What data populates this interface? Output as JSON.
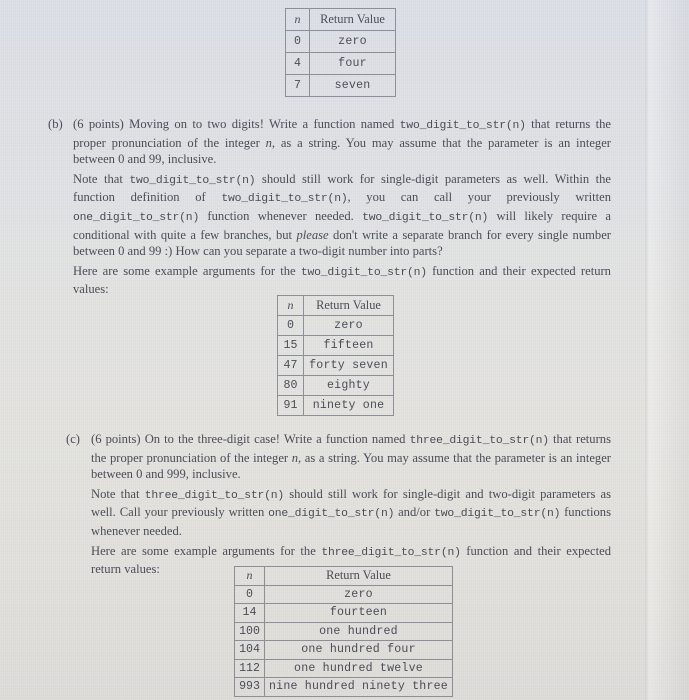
{
  "document": {
    "type": "scanned-assignment-page",
    "background_color": "#e3e3e1",
    "text_color": "#4a4d58",
    "rule_color": "#8d8f98"
  },
  "tables": {
    "one_digit": {
      "name": "one-digit-example-table",
      "headers": [
        "n",
        "Return Value"
      ],
      "rows": [
        [
          "0",
          "zero"
        ],
        [
          "4",
          "four"
        ],
        [
          "7",
          "seven"
        ]
      ]
    },
    "two_digit": {
      "name": "two-digit-example-table",
      "headers": [
        "n",
        "Return Value"
      ],
      "rows": [
        [
          "0",
          "zero"
        ],
        [
          "15",
          "fifteen"
        ],
        [
          "47",
          "forty seven"
        ],
        [
          "80",
          "eighty"
        ],
        [
          "91",
          "ninety one"
        ]
      ]
    },
    "three_digit": {
      "name": "three-digit-example-table",
      "headers": [
        "n",
        "Return Value"
      ],
      "rows": [
        [
          "0",
          "zero"
        ],
        [
          "14",
          "fourteen"
        ],
        [
          "100",
          "one hundred"
        ],
        [
          "104",
          "one hundred four"
        ],
        [
          "112",
          "one hundred twelve"
        ],
        [
          "993",
          "nine hundred ninety three"
        ]
      ]
    }
  },
  "part_b": {
    "label": "(b)",
    "points": "(6 points)",
    "p1_a": "Moving on to two digits! Write a function named ",
    "p1_fn": "two_digit_to_str(n)",
    "p1_b": " that returns the proper pronunciation of the integer ",
    "p1_var": "n",
    "p1_c": ", as a string. You may assume that the parameter is an integer between 0 and 99, inclusive.",
    "p2_a": "Note that ",
    "p2_fn1": "two_digit_to_str(n)",
    "p2_b": " should still work for single-digit parameters as well. Within the function definition of ",
    "p2_fn2": "two_digit_to_str(n)",
    "p2_c": ", you can call your previously written ",
    "p2_fn3": "one_digit_to_str(n)",
    "p2_d": " function whenever needed. ",
    "p2_fn4": "two_digit_to_str(n)",
    "p2_e": " will likely require a conditional with quite a few branches, but ",
    "p2_em": "please",
    "p2_f": " don't write a separate branch for every single number between 0 and 99 :) How can you separate a two-digit number into parts?",
    "p3_a": "Here are some example arguments for the ",
    "p3_fn": "two_digit_to_str(n)",
    "p3_b": " function and their expected return values:"
  },
  "part_c": {
    "label": "(c)",
    "points": "(6 points)",
    "p1_a": "On to the three-digit case! Write a function named ",
    "p1_fn": "three_digit_to_str(n)",
    "p1_b": " that returns the proper pronunciation of the integer ",
    "p1_var": "n",
    "p1_c": ", as a string. You may assume that the parameter is an integer between 0 and 999, inclusive.",
    "p2_a": "Note that ",
    "p2_fn1": "three_digit_to_str(n)",
    "p2_b": " should still work for single-digit and two-digit parameters as well. Call your previously written ",
    "p2_fn2": "one_digit_to_str(n)",
    "p2_c": " and/or ",
    "p2_fn3": "two_digit_to_str(n)",
    "p2_d": " functions whenever needed.",
    "p3_a": "Here are some example arguments for the ",
    "p3_fn": "three_digit_to_str(n)",
    "p3_b": " function and their expected return values:"
  }
}
